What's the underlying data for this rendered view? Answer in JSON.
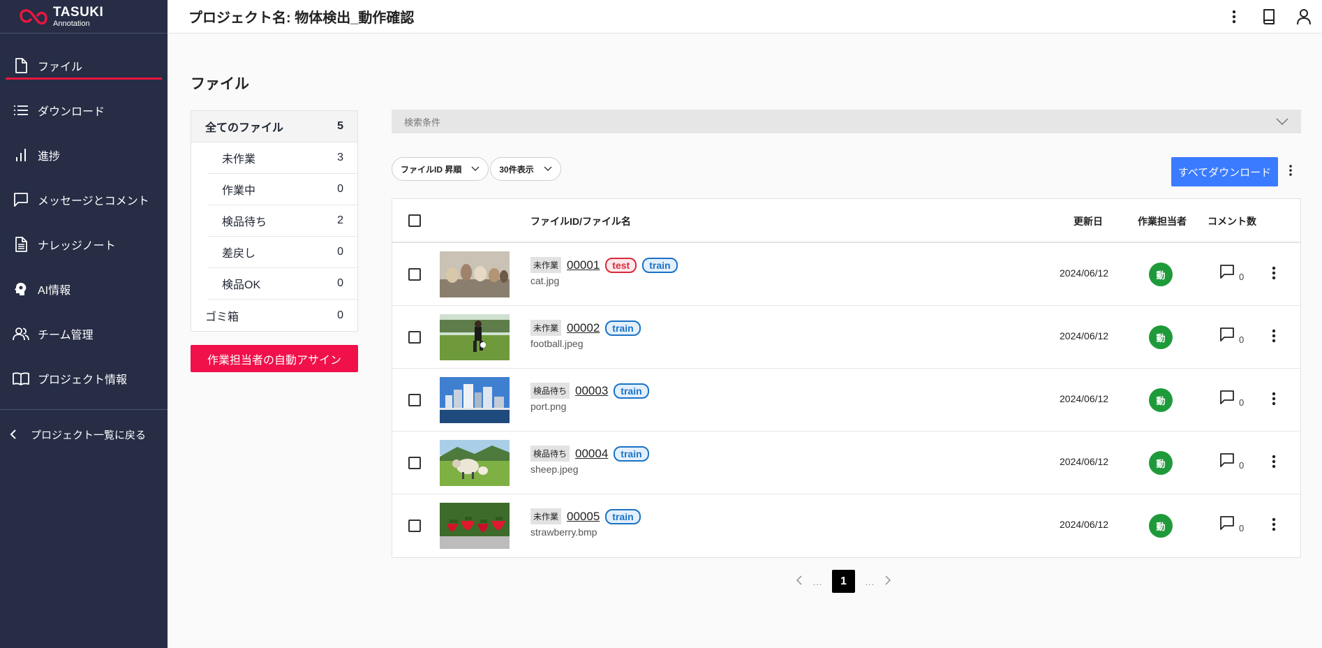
{
  "app": {
    "logo_line1": "TASUKI",
    "logo_line2": "Annotation",
    "brand_color": "#e8173f"
  },
  "sidebar": {
    "items": [
      {
        "label": "ファイル",
        "icon": "file-icon",
        "active": true
      },
      {
        "label": "ダウンロード",
        "icon": "list-icon"
      },
      {
        "label": "進捗",
        "icon": "bar-chart-icon"
      },
      {
        "label": "メッセージとコメント",
        "icon": "message-icon"
      },
      {
        "label": "ナレッジノート",
        "icon": "document-icon"
      },
      {
        "label": "AI情報",
        "icon": "ai-head-icon"
      },
      {
        "label": "チーム管理",
        "icon": "team-icon"
      },
      {
        "label": "プロジェクト情報",
        "icon": "book-icon"
      }
    ],
    "back_label": "プロジェクト一覧に戻る"
  },
  "header": {
    "project_title": "プロジェクト名: 物体検出_動作確認"
  },
  "main": {
    "page_title": "ファイル",
    "status_panel": {
      "all": {
        "label": "全てのファイル",
        "count": "5"
      },
      "statuses": [
        {
          "label": "未作業",
          "count": "3"
        },
        {
          "label": "作業中",
          "count": "0"
        },
        {
          "label": "検品待ち",
          "count": "2"
        },
        {
          "label": "差戻し",
          "count": "0"
        },
        {
          "label": "検品OK",
          "count": "0"
        }
      ],
      "trash": {
        "label": "ゴミ箱",
        "count": "0"
      }
    },
    "auto_assign_label": "作業担当者の自動アサイン",
    "search_label": "検索条件",
    "sort_select": "ファイルID 昇順",
    "per_page_select": "30件表示",
    "download_all_label": "すべてダウンロード",
    "table": {
      "headers": {
        "file": "ファイルID/ファイル名",
        "date": "更新日",
        "assignee": "作業担当者",
        "comments": "コメント数"
      },
      "rows": [
        {
          "status": "未作業",
          "id": "00001",
          "tags": [
            "test",
            "train"
          ],
          "filename": "cat.jpg",
          "date": "2024/06/12",
          "assignee": "動",
          "comments": "0",
          "thumb": "cats"
        },
        {
          "status": "未作業",
          "id": "00002",
          "tags": [
            "train"
          ],
          "filename": "football.jpeg",
          "date": "2024/06/12",
          "assignee": "動",
          "comments": "0",
          "thumb": "football"
        },
        {
          "status": "検品待ち",
          "id": "00003",
          "tags": [
            "train"
          ],
          "filename": "port.png",
          "date": "2024/06/12",
          "assignee": "動",
          "comments": "0",
          "thumb": "port"
        },
        {
          "status": "検品待ち",
          "id": "00004",
          "tags": [
            "train"
          ],
          "filename": "sheep.jpeg",
          "date": "2024/06/12",
          "assignee": "動",
          "comments": "0",
          "thumb": "sheep"
        },
        {
          "status": "未作業",
          "id": "00005",
          "tags": [
            "train"
          ],
          "filename": "strawberry.bmp",
          "date": "2024/06/12",
          "assignee": "動",
          "comments": "0",
          "thumb": "strawberry"
        }
      ]
    },
    "pager": {
      "current": "1",
      "ellipsis": "…"
    }
  }
}
